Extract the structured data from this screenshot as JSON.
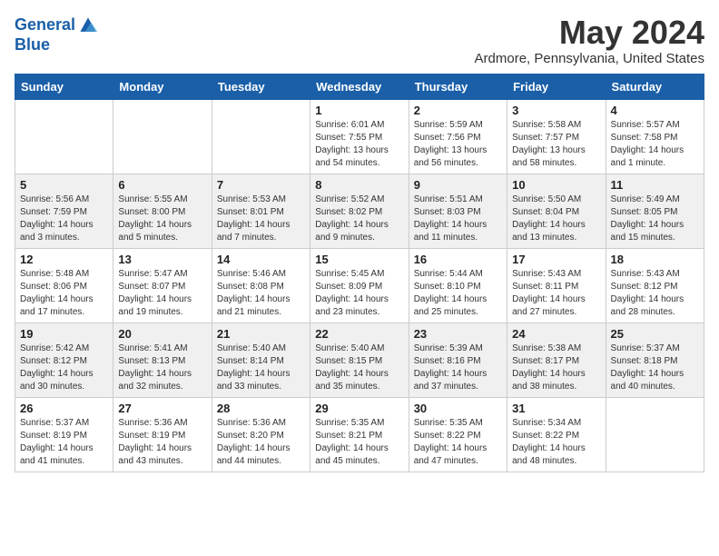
{
  "logo": {
    "line1": "General",
    "line2": "Blue"
  },
  "title": "May 2024",
  "location": "Ardmore, Pennsylvania, United States",
  "days_header": [
    "Sunday",
    "Monday",
    "Tuesday",
    "Wednesday",
    "Thursday",
    "Friday",
    "Saturday"
  ],
  "weeks": [
    [
      {
        "day": "",
        "info": ""
      },
      {
        "day": "",
        "info": ""
      },
      {
        "day": "",
        "info": ""
      },
      {
        "day": "1",
        "info": "Sunrise: 6:01 AM\nSunset: 7:55 PM\nDaylight: 13 hours\nand 54 minutes."
      },
      {
        "day": "2",
        "info": "Sunrise: 5:59 AM\nSunset: 7:56 PM\nDaylight: 13 hours\nand 56 minutes."
      },
      {
        "day": "3",
        "info": "Sunrise: 5:58 AM\nSunset: 7:57 PM\nDaylight: 13 hours\nand 58 minutes."
      },
      {
        "day": "4",
        "info": "Sunrise: 5:57 AM\nSunset: 7:58 PM\nDaylight: 14 hours\nand 1 minute."
      }
    ],
    [
      {
        "day": "5",
        "info": "Sunrise: 5:56 AM\nSunset: 7:59 PM\nDaylight: 14 hours\nand 3 minutes."
      },
      {
        "day": "6",
        "info": "Sunrise: 5:55 AM\nSunset: 8:00 PM\nDaylight: 14 hours\nand 5 minutes."
      },
      {
        "day": "7",
        "info": "Sunrise: 5:53 AM\nSunset: 8:01 PM\nDaylight: 14 hours\nand 7 minutes."
      },
      {
        "day": "8",
        "info": "Sunrise: 5:52 AM\nSunset: 8:02 PM\nDaylight: 14 hours\nand 9 minutes."
      },
      {
        "day": "9",
        "info": "Sunrise: 5:51 AM\nSunset: 8:03 PM\nDaylight: 14 hours\nand 11 minutes."
      },
      {
        "day": "10",
        "info": "Sunrise: 5:50 AM\nSunset: 8:04 PM\nDaylight: 14 hours\nand 13 minutes."
      },
      {
        "day": "11",
        "info": "Sunrise: 5:49 AM\nSunset: 8:05 PM\nDaylight: 14 hours\nand 15 minutes."
      }
    ],
    [
      {
        "day": "12",
        "info": "Sunrise: 5:48 AM\nSunset: 8:06 PM\nDaylight: 14 hours\nand 17 minutes."
      },
      {
        "day": "13",
        "info": "Sunrise: 5:47 AM\nSunset: 8:07 PM\nDaylight: 14 hours\nand 19 minutes."
      },
      {
        "day": "14",
        "info": "Sunrise: 5:46 AM\nSunset: 8:08 PM\nDaylight: 14 hours\nand 21 minutes."
      },
      {
        "day": "15",
        "info": "Sunrise: 5:45 AM\nSunset: 8:09 PM\nDaylight: 14 hours\nand 23 minutes."
      },
      {
        "day": "16",
        "info": "Sunrise: 5:44 AM\nSunset: 8:10 PM\nDaylight: 14 hours\nand 25 minutes."
      },
      {
        "day": "17",
        "info": "Sunrise: 5:43 AM\nSunset: 8:11 PM\nDaylight: 14 hours\nand 27 minutes."
      },
      {
        "day": "18",
        "info": "Sunrise: 5:43 AM\nSunset: 8:12 PM\nDaylight: 14 hours\nand 28 minutes."
      }
    ],
    [
      {
        "day": "19",
        "info": "Sunrise: 5:42 AM\nSunset: 8:12 PM\nDaylight: 14 hours\nand 30 minutes."
      },
      {
        "day": "20",
        "info": "Sunrise: 5:41 AM\nSunset: 8:13 PM\nDaylight: 14 hours\nand 32 minutes."
      },
      {
        "day": "21",
        "info": "Sunrise: 5:40 AM\nSunset: 8:14 PM\nDaylight: 14 hours\nand 33 minutes."
      },
      {
        "day": "22",
        "info": "Sunrise: 5:40 AM\nSunset: 8:15 PM\nDaylight: 14 hours\nand 35 minutes."
      },
      {
        "day": "23",
        "info": "Sunrise: 5:39 AM\nSunset: 8:16 PM\nDaylight: 14 hours\nand 37 minutes."
      },
      {
        "day": "24",
        "info": "Sunrise: 5:38 AM\nSunset: 8:17 PM\nDaylight: 14 hours\nand 38 minutes."
      },
      {
        "day": "25",
        "info": "Sunrise: 5:37 AM\nSunset: 8:18 PM\nDaylight: 14 hours\nand 40 minutes."
      }
    ],
    [
      {
        "day": "26",
        "info": "Sunrise: 5:37 AM\nSunset: 8:19 PM\nDaylight: 14 hours\nand 41 minutes."
      },
      {
        "day": "27",
        "info": "Sunrise: 5:36 AM\nSunset: 8:19 PM\nDaylight: 14 hours\nand 43 minutes."
      },
      {
        "day": "28",
        "info": "Sunrise: 5:36 AM\nSunset: 8:20 PM\nDaylight: 14 hours\nand 44 minutes."
      },
      {
        "day": "29",
        "info": "Sunrise: 5:35 AM\nSunset: 8:21 PM\nDaylight: 14 hours\nand 45 minutes."
      },
      {
        "day": "30",
        "info": "Sunrise: 5:35 AM\nSunset: 8:22 PM\nDaylight: 14 hours\nand 47 minutes."
      },
      {
        "day": "31",
        "info": "Sunrise: 5:34 AM\nSunset: 8:22 PM\nDaylight: 14 hours\nand 48 minutes."
      },
      {
        "day": "",
        "info": ""
      }
    ]
  ]
}
